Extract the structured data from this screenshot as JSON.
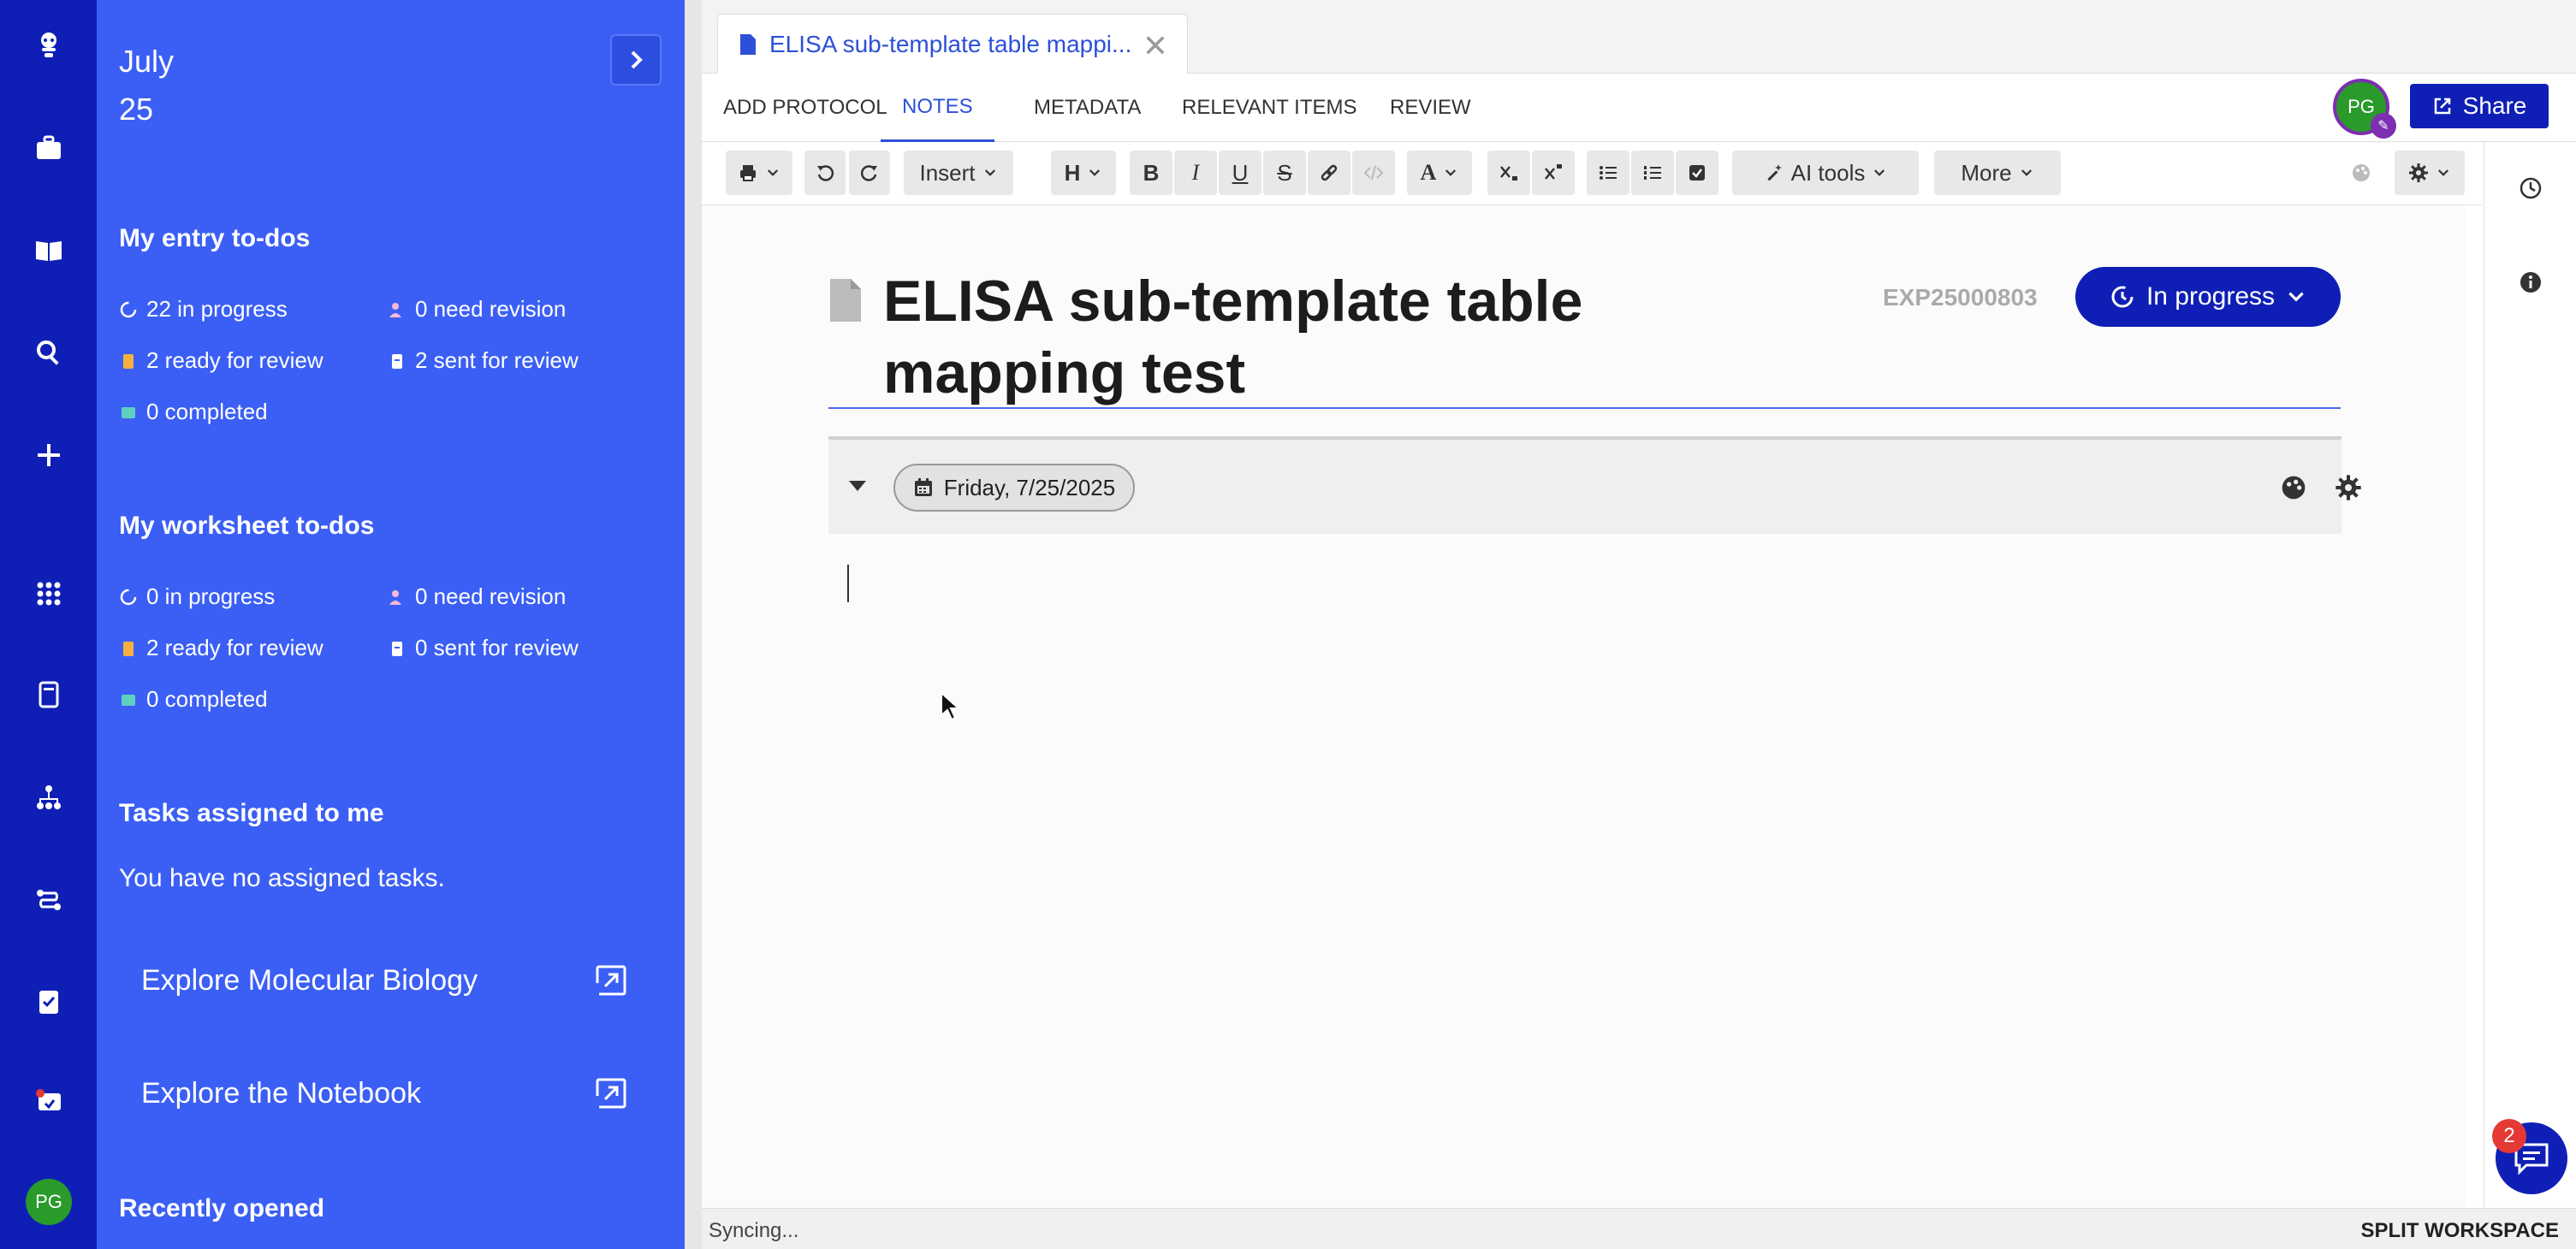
{
  "panel": {
    "date_month": "July",
    "date_day": "25",
    "entry_todos": {
      "title": "My entry to-dos",
      "in_progress": "22 in progress",
      "need_revision": "0 need revision",
      "ready_for_review": "2 ready for review",
      "sent_for_review": "2 sent for review",
      "completed": "0 completed"
    },
    "worksheet_todos": {
      "title": "My worksheet to-dos",
      "in_progress": "0 in progress",
      "need_revision": "0 need revision",
      "ready_for_review": "2 ready for review",
      "sent_for_review": "0 sent for review",
      "completed": "0 completed"
    },
    "tasks": {
      "title": "Tasks assigned to me",
      "empty": "You have no assigned tasks."
    },
    "explore": [
      "Explore Molecular Biology",
      "Explore the Notebook"
    ],
    "recent_title": "Recently opened"
  },
  "rail": {
    "avatar": "PG",
    "icons": [
      "robot-icon",
      "briefcase-icon",
      "book-icon",
      "search-icon",
      "plus-icon",
      "apps-grid-icon",
      "notebook-icon",
      "hierarchy-icon",
      "workflow-icon",
      "clipboard-check-icon",
      "inbox-icon"
    ]
  },
  "tab": {
    "title": "ELISA sub-template table mappi...",
    "close": "✕"
  },
  "nav": {
    "tabs": [
      "ADD PROTOCOL",
      "NOTES",
      "METADATA",
      "RELEVANT ITEMS",
      "REVIEW"
    ],
    "active": "NOTES",
    "avatar": "PG",
    "share": "Share"
  },
  "toolbar": {
    "insert": "Insert",
    "heading": "H",
    "bold": "B",
    "italic": "I",
    "underline": "U",
    "strike": "S",
    "font_color": "A",
    "ai_tools": "AI tools",
    "more": "More"
  },
  "document": {
    "title": "ELISA sub-template table mapping test",
    "exp_id": "EXP25000803",
    "status": "In progress",
    "entry_date": "Friday, 7/25/2025"
  },
  "status_bar": {
    "syncing": "Syncing...",
    "split": "SPLIT WORKSPACE"
  },
  "chat": {
    "badge": "2"
  },
  "colors": {
    "rail_bg": "#0f1fb5",
    "panel_bg": "#3b5ff5",
    "accent": "#2d50d8",
    "avatar_green": "#2a9a2a"
  }
}
